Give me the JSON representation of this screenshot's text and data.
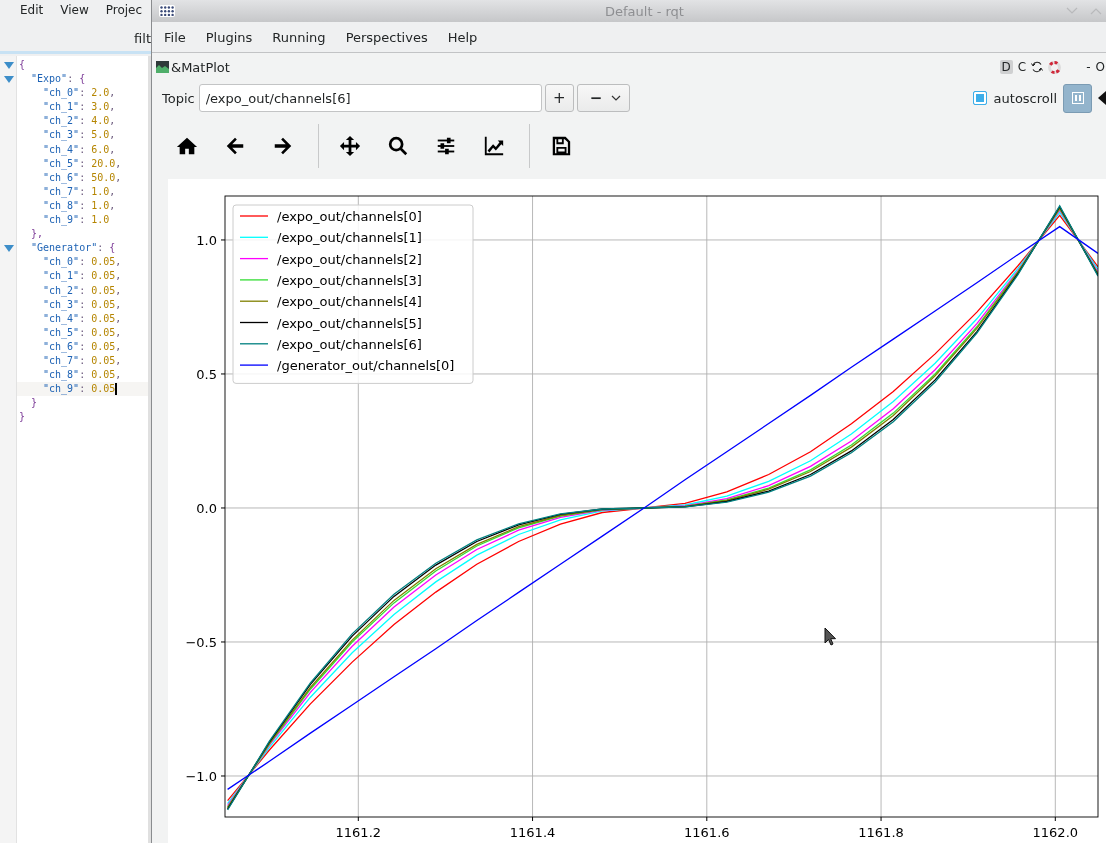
{
  "background_app": {
    "menu": [
      "Edit",
      "View",
      "Projec"
    ],
    "filter_label": "filt",
    "editor": {
      "tree": {
        "kind": "object",
        "expanded": true,
        "open": "{",
        "close": "}",
        "children": [
          {
            "kind": "object",
            "key": "\"Expo\"",
            "separator": ":",
            "expanded": true,
            "open": "{",
            "close": "},",
            "children": [
              {
                "kind": "pair",
                "key": "\"ch_0\"",
                "separator": ":",
                "value": "2.0",
                "punct": ",",
                "current": false
              },
              {
                "kind": "pair",
                "key": "\"ch_1\"",
                "separator": ":",
                "value": "3.0",
                "punct": ",",
                "current": false
              },
              {
                "kind": "pair",
                "key": "\"ch_2\"",
                "separator": ":",
                "value": "4.0",
                "punct": ",",
                "current": false
              },
              {
                "kind": "pair",
                "key": "\"ch_3\"",
                "separator": ":",
                "value": "5.0",
                "punct": ",",
                "current": false
              },
              {
                "kind": "pair",
                "key": "\"ch_4\"",
                "separator": ":",
                "value": "6.0",
                "punct": ",",
                "current": false
              },
              {
                "kind": "pair",
                "key": "\"ch_5\"",
                "separator": ":",
                "value": "20.0",
                "punct": ",",
                "current": false
              },
              {
                "kind": "pair",
                "key": "\"ch_6\"",
                "separator": ":",
                "value": "50.0",
                "punct": ",",
                "current": false
              },
              {
                "kind": "pair",
                "key": "\"ch_7\"",
                "separator": ":",
                "value": "1.0",
                "punct": ",",
                "current": false
              },
              {
                "kind": "pair",
                "key": "\"ch_8\"",
                "separator": ":",
                "value": "1.0",
                "punct": ",",
                "current": false
              },
              {
                "kind": "pair",
                "key": "\"ch_9\"",
                "separator": ":",
                "value": "1.0",
                "current": false
              }
            ]
          },
          {
            "kind": "object",
            "key": "\"Generator\"",
            "separator": ":",
            "expanded": true,
            "open": "{",
            "close": "}",
            "children": [
              {
                "kind": "pair",
                "key": "\"ch_0\"",
                "separator": ":",
                "value": "0.05",
                "punct": ",",
                "current": false
              },
              {
                "kind": "pair",
                "key": "\"ch_1\"",
                "separator": ":",
                "value": "0.05",
                "punct": ",",
                "current": false
              },
              {
                "kind": "pair",
                "key": "\"ch_2\"",
                "separator": ":",
                "value": "0.05",
                "punct": ",",
                "current": false
              },
              {
                "kind": "pair",
                "key": "\"ch_3\"",
                "separator": ":",
                "value": "0.05",
                "punct": ",",
                "current": false
              },
              {
                "kind": "pair",
                "key": "\"ch_4\"",
                "separator": ":",
                "value": "0.05",
                "punct": ",",
                "current": false
              },
              {
                "kind": "pair",
                "key": "\"ch_5\"",
                "separator": ":",
                "value": "0.05",
                "punct": ",",
                "current": false
              },
              {
                "kind": "pair",
                "key": "\"ch_6\"",
                "separator": ":",
                "value": "0.05",
                "punct": ",",
                "current": false
              },
              {
                "kind": "pair",
                "key": "\"ch_7\"",
                "separator": ":",
                "value": "0.05",
                "punct": ",",
                "current": false
              },
              {
                "kind": "pair",
                "key": "\"ch_8\"",
                "separator": ":",
                "value": "0.05",
                "punct": ",",
                "current": false
              },
              {
                "kind": "pair",
                "key": "\"ch_9\"",
                "separator": ":",
                "value": "0.05",
                "current": true
              }
            ]
          }
        ]
      }
    }
  },
  "window": {
    "title": "Default - rqt",
    "menu": [
      "File",
      "Plugins",
      "Running",
      "Perspectives",
      "Help"
    ],
    "plugin": {
      "title": "&MatPlot",
      "header_buttons": [
        {
          "kind": "badge",
          "label": "D"
        },
        {
          "kind": "text",
          "label": "C"
        },
        {
          "kind": "reload"
        },
        {
          "kind": "help"
        },
        {
          "kind": "text",
          "label": "-"
        },
        {
          "kind": "text",
          "label": "O"
        }
      ],
      "topic": {
        "label": "Topic",
        "value": "/expo_out/channels[6]"
      },
      "add_button": "+",
      "remove_button": "−",
      "autoscroll": {
        "label": "autoscroll",
        "checked": true
      },
      "pause_button": {
        "pressed": true
      },
      "toolbar": [
        {
          "kind": "home"
        },
        {
          "kind": "back"
        },
        {
          "kind": "forward"
        },
        {
          "kind": "separator"
        },
        {
          "kind": "pan"
        },
        {
          "kind": "zoom"
        },
        {
          "kind": "subplots"
        },
        {
          "kind": "customize"
        },
        {
          "kind": "separator"
        },
        {
          "kind": "save"
        }
      ],
      "chart_data": {
        "type": "line",
        "x": [
          1161.05,
          1161.098,
          1161.145,
          1161.193,
          1161.241,
          1161.289,
          1161.336,
          1161.384,
          1161.432,
          1161.48,
          1161.528,
          1161.575,
          1161.623,
          1161.671,
          1161.719,
          1161.766,
          1161.814,
          1161.862,
          1161.91,
          1161.957,
          1162.005,
          1162.049
        ],
        "series": [
          {
            "name": "/expo_out/channels[0]",
            "color": "#ff0000",
            "values": [
              -1.092,
              -0.903,
              -0.731,
              -0.575,
              -0.435,
              -0.314,
              -0.21,
              -0.125,
              -0.06,
              -0.017,
              0,
              0.017,
              0.06,
              0.125,
              0.21,
              0.314,
              0.435,
              0.575,
              0.731,
              0.903,
              1.092,
              0.9
            ]
          },
          {
            "name": "/expo_out/channels[1]",
            "color": "#00ffff",
            "values": [
              -1.103,
              -0.893,
              -0.706,
              -0.54,
              -0.397,
              -0.276,
              -0.176,
              -0.099,
              -0.044,
              -0.011,
              0,
              0.011,
              0.044,
              0.099,
              0.176,
              0.276,
              0.397,
              0.54,
              0.706,
              0.893,
              1.103,
              0.89
            ]
          },
          {
            "name": "/expo_out/channels[2]",
            "color": "#ff00ff",
            "values": [
              -1.111,
              -0.885,
              -0.688,
              -0.516,
              -0.37,
              -0.25,
              -0.155,
              -0.083,
              -0.035,
              -0.008,
              0,
              0.008,
              0.035,
              0.083,
              0.155,
              0.25,
              0.37,
              0.516,
              0.688,
              0.885,
              1.111,
              0.88
            ]
          },
          {
            "name": "/expo_out/channels[3]",
            "color": "#33dd33",
            "values": [
              -1.116,
              -0.881,
              -0.676,
              -0.5,
              -0.354,
              -0.235,
              -0.142,
              -0.074,
              -0.03,
              -0.006,
              0,
              0.006,
              0.03,
              0.074,
              0.142,
              0.235,
              0.354,
              0.5,
              0.676,
              0.881,
              1.116,
              0.875
            ]
          },
          {
            "name": "/expo_out/channels[4]",
            "color": "#808000",
            "values": [
              -1.119,
              -0.878,
              -0.67,
              -0.493,
              -0.345,
              -0.227,
              -0.136,
              -0.07,
              -0.028,
              -0.006,
              0,
              0.006,
              0.028,
              0.07,
              0.136,
              0.227,
              0.345,
              0.493,
              0.67,
              0.878,
              1.119,
              0.872
            ]
          },
          {
            "name": "/expo_out/channels[5]",
            "color": "#000000",
            "values": [
              -1.124,
              -0.873,
              -0.658,
              -0.478,
              -0.33,
              -0.213,
              -0.125,
              -0.063,
              -0.024,
              -0.004,
              0,
              0.004,
              0.024,
              0.063,
              0.125,
              0.213,
              0.33,
              0.478,
              0.658,
              0.873,
              1.124,
              0.868
            ]
          },
          {
            "name": "/expo_out/channels[6]",
            "color": "#008080",
            "values": [
              -1.127,
              -0.87,
              -0.653,
              -0.47,
              -0.322,
              -0.206,
              -0.119,
              -0.059,
              -0.022,
              -0.004,
              0,
              0.004,
              0.022,
              0.059,
              0.119,
              0.206,
              0.322,
              0.47,
              0.653,
              0.87,
              1.127,
              0.865
            ]
          },
          {
            "name": "/generator_out/channels[0]",
            "color": "#0000ff",
            "values": [
              -1.05,
              -0.945,
              -0.84,
              -0.735,
              -0.63,
              -0.525,
              -0.42,
              -0.315,
              -0.21,
              -0.105,
              0,
              0.105,
              0.21,
              0.315,
              0.42,
              0.525,
              0.63,
              0.735,
              0.84,
              0.945,
              1.05,
              0.95
            ]
          }
        ],
        "grid": true,
        "legend": true,
        "xlim": [
          1161.047,
          1162.049
        ],
        "ylim": [
          -1.153,
          1.164
        ],
        "xticks": [
          {
            "value": 1161.2,
            "label": "1161.2"
          },
          {
            "value": 1161.4,
            "label": "1161.4"
          },
          {
            "value": 1161.6,
            "label": "1161.6"
          },
          {
            "value": 1161.8,
            "label": "1161.8"
          },
          {
            "value": 1162.0,
            "label": "1162.0"
          }
        ],
        "yticks": [
          {
            "value": 1.0,
            "label": "1.0"
          },
          {
            "value": 0.5,
            "label": "0.5"
          },
          {
            "value": 0.0,
            "label": "0.0"
          },
          {
            "value": -0.5,
            "label": "−0.5"
          },
          {
            "value": -1.0,
            "label": "−1.0"
          }
        ]
      }
    }
  }
}
